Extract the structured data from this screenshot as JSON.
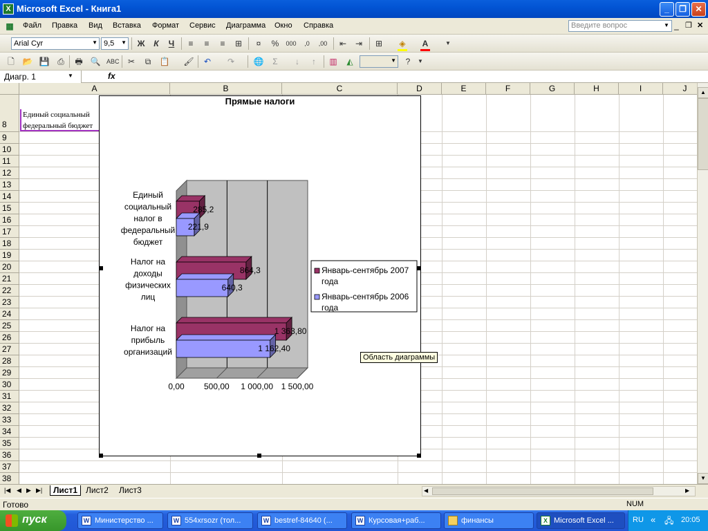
{
  "window": {
    "title": "Microsoft Excel - Книга1"
  },
  "menu": [
    "Файл",
    "Правка",
    "Вид",
    "Вставка",
    "Формат",
    "Сервис",
    "Диаграмма",
    "Окно",
    "Справка"
  ],
  "help_box": {
    "placeholder": "Введите вопрос"
  },
  "format_toolbar": {
    "font": "Arial Cyr",
    "size": "9,5"
  },
  "formula_bar": {
    "name_box": "Диагр. 1",
    "fx": "fx"
  },
  "columns": [
    "A",
    "B",
    "C",
    "D",
    "E",
    "F",
    "G",
    "H",
    "I",
    "J"
  ],
  "rows": [
    "8",
    "9",
    "10",
    "11",
    "12",
    "13",
    "14",
    "15",
    "16",
    "17",
    "18",
    "19",
    "20",
    "21",
    "22",
    "23",
    "24",
    "25",
    "26",
    "27",
    "28",
    "29",
    "30",
    "31",
    "32",
    "33",
    "34",
    "35",
    "36",
    "37",
    "38"
  ],
  "cell_a8": {
    "line1": "Единый социальный",
    "line2": "федеральный бюджет"
  },
  "chart_data": {
    "type": "bar",
    "orientation": "horizontal",
    "three_d": true,
    "title": "Прямые налоги",
    "categories": [
      "Единый социальный налог в федеральный бюджет",
      "Налог на доходы физических лиц",
      "Налог на прибыль организаций"
    ],
    "category_label_lines": [
      [
        "Единый",
        "социальный",
        "налог в",
        "федеральный",
        "бюджет"
      ],
      [
        "Налог на",
        "доходы",
        "физических",
        "лиц"
      ],
      [
        "Налог на",
        "прибыль",
        "организаций"
      ]
    ],
    "series": [
      {
        "name": "Январь-сентябрь 2007 года",
        "legend_lines": [
          "Январь-сентябрь 2007",
          "года"
        ],
        "values": [
          285.2,
          864.3,
          1363.8
        ],
        "labels": [
          "285,2",
          "864,3",
          "1 363,80"
        ],
        "color": "#993366"
      },
      {
        "name": "Январь-сентябрь 2006 года",
        "legend_lines": [
          "Январь-сентябрь 2006",
          "года"
        ],
        "values": [
          221.9,
          640.3,
          1162.4
        ],
        "labels": [
          "221,9",
          "640,3",
          "1 162,40"
        ],
        "color": "#9999ff"
      }
    ],
    "x_ticks": [
      "0,00",
      "500,00",
      "1 000,00",
      "1 500,00"
    ],
    "xlim": [
      0,
      1500
    ],
    "grid": true,
    "legend": "right"
  },
  "tooltip": "Область диаграммы",
  "sheets": [
    "Лист1",
    "Лист2",
    "Лист3"
  ],
  "status": {
    "ready": "Готово",
    "num": "NUM"
  },
  "taskbar": {
    "start": "пуск",
    "tasks": [
      "Министерство ...",
      "554xrsozr (тол...",
      "bestref-84640 (...",
      "Курсовая+раб...",
      "финансы",
      "Microsoft Excel ..."
    ],
    "lang": "RU",
    "clock": "20:05"
  }
}
